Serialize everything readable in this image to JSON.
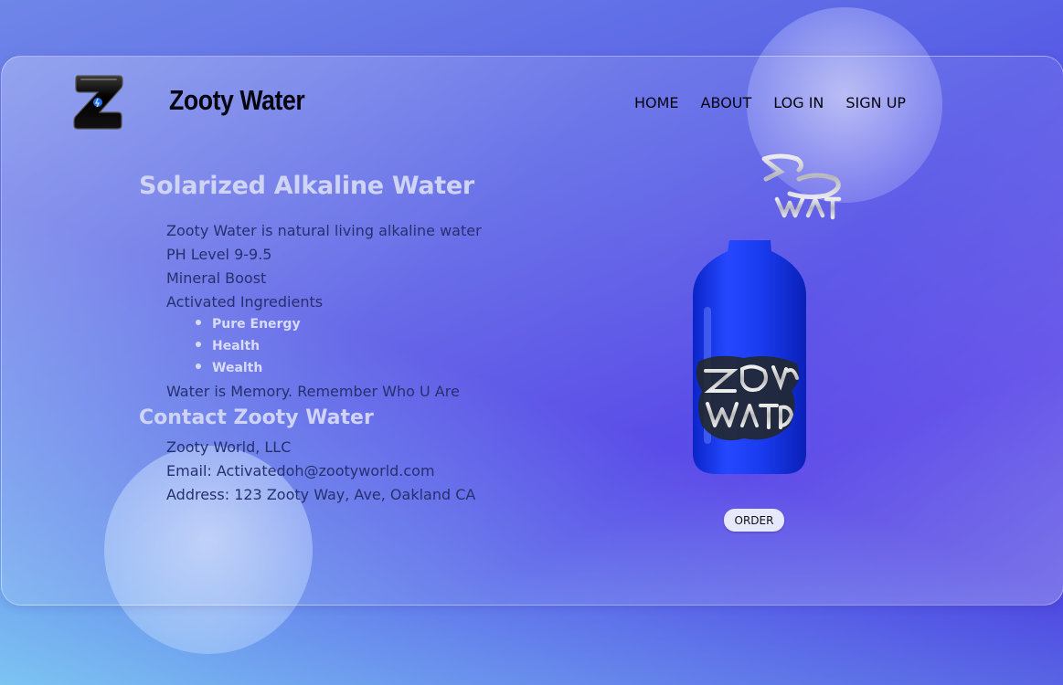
{
  "brand": {
    "name": "Zooty Water",
    "logo_letter": "Z",
    "bottle_label": "ZOOTY WATER"
  },
  "nav": {
    "items": [
      {
        "label": "HOME"
      },
      {
        "label": "ABOUT"
      },
      {
        "label": "LOG IN"
      },
      {
        "label": "SIGN UP"
      }
    ]
  },
  "main": {
    "heading": "Solarized Alkaline Water",
    "lines": [
      "Zooty Water is natural living alkaline water",
      "PH Level 9-9.5",
      "Mineral Boost",
      "Activated Ingredients"
    ],
    "bullets": [
      "Pure Energy",
      "Health",
      "Wealth"
    ],
    "tagline": "Water is Memory. Remember Who U Are"
  },
  "contact": {
    "heading": "Contact Zooty Water",
    "company": "Zooty World, LLC",
    "email": "Email: Activatedoh@zootyworld.com",
    "address": "Address: 123 Zooty Way, Ave, Oakland CA"
  },
  "order": {
    "label": "ORDER"
  },
  "colors": {
    "background_start": "#6f86e8",
    "background_end": "#4a35e6",
    "heading": "#cfd4f5",
    "body_text": "#26306e",
    "bottle_blue": "#1e3be8"
  }
}
